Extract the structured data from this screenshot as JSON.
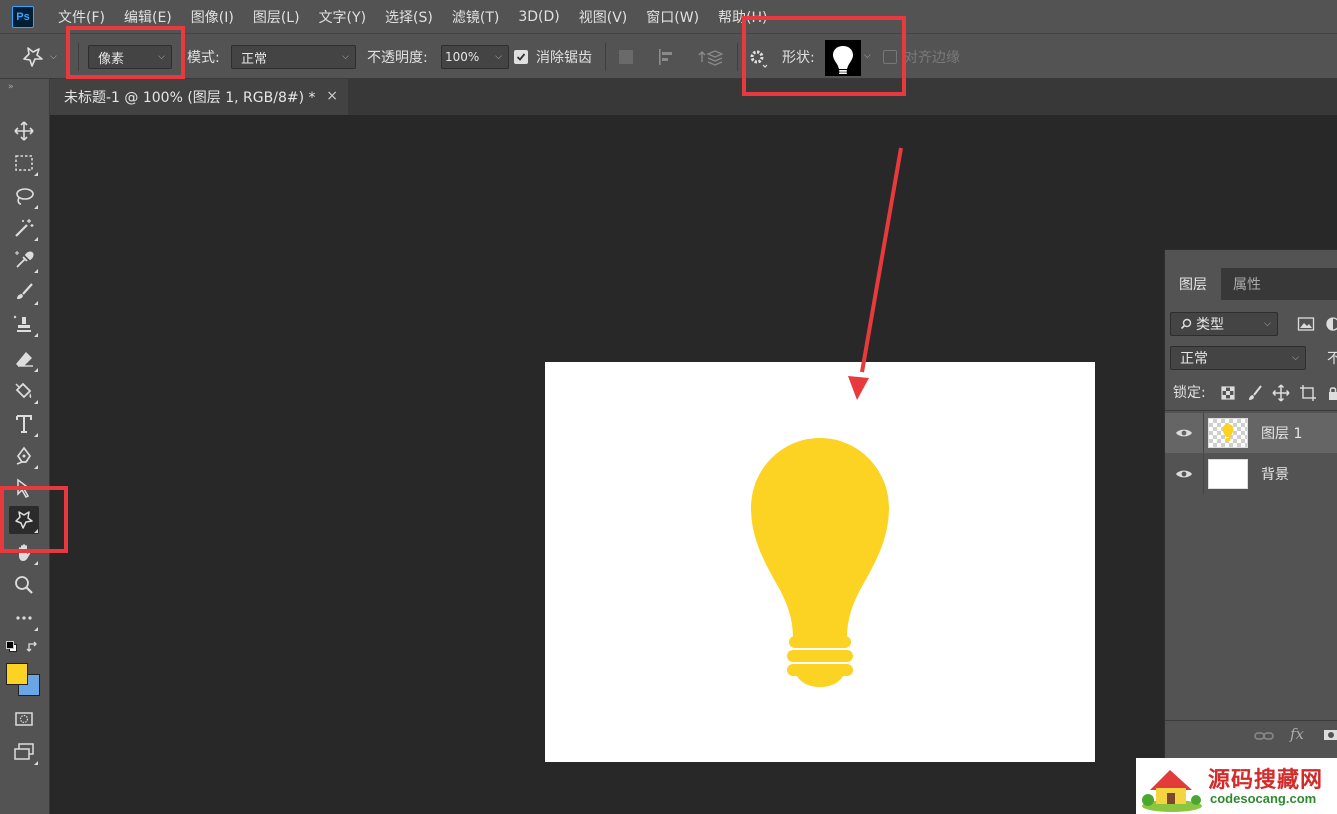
{
  "app": {
    "logo": "Ps"
  },
  "menu": [
    "文件(F)",
    "编辑(E)",
    "图像(I)",
    "图层(L)",
    "文字(Y)",
    "选择(S)",
    "滤镜(T)",
    "3D(D)",
    "视图(V)",
    "窗口(W)",
    "帮助(H)"
  ],
  "options": {
    "fill_type": "像素",
    "mode_label": "模式:",
    "mode_value": "正常",
    "opacity_label": "不透明度:",
    "opacity_value": "100%",
    "antialias_label": "消除锯齿",
    "antialias_checked": true,
    "shape_label": "形状:",
    "align_edges_label": "对齐边缘",
    "align_edges_checked": false
  },
  "document": {
    "tab_title": "未标题-1 @ 100% (图层 1, RGB/8#) *",
    "close_glyph": "×"
  },
  "colors": {
    "foreground": "#fcd223",
    "background": "#6aa6e6",
    "bulb": "#fcd223",
    "highlight": "#e8393c"
  },
  "layers_panel": {
    "tabs": [
      "图层",
      "属性"
    ],
    "filter_label": "类型",
    "blend_mode": "正常",
    "opacity_cut": "不",
    "lock_label": "锁定:",
    "layers": [
      {
        "name": "图层 1",
        "selected": true
      },
      {
        "name": "背景",
        "selected": false
      }
    ],
    "fx_label": "fx"
  },
  "watermark": {
    "title": "源码搜藏网",
    "url": "codesocang.com"
  }
}
